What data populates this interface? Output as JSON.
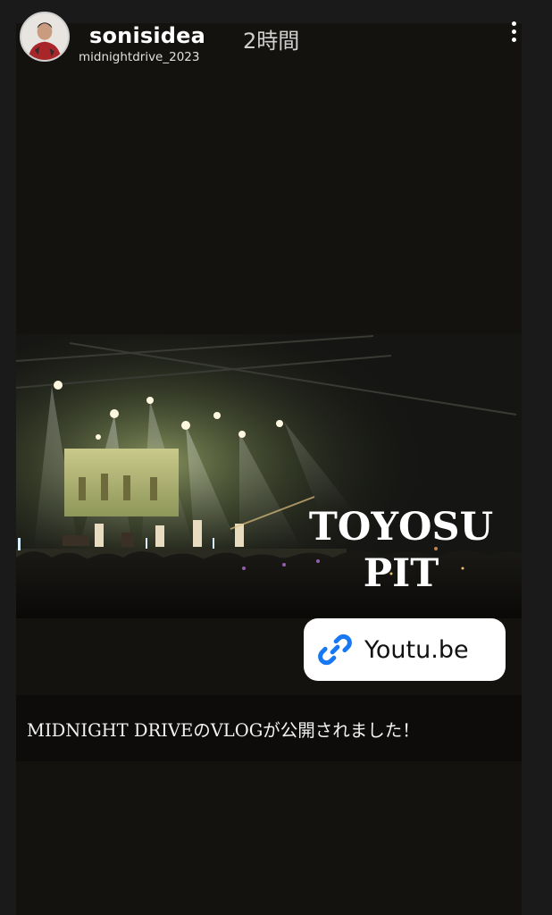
{
  "header": {
    "username": "sonisidea",
    "time_ago": "2時間",
    "sub_account": "midnightdrive_2023",
    "avatar_icon": "profile-avatar",
    "more_icon": "more-vertical-icon"
  },
  "story": {
    "venue_line1": "TOYOSU",
    "venue_line2": "PIT",
    "link_sticker": {
      "icon": "link-icon",
      "label": "Youtu.be",
      "icon_color": "#1877f2"
    },
    "caption": "MIDNIGHT DRIVEのVLOGが公開されました！"
  }
}
